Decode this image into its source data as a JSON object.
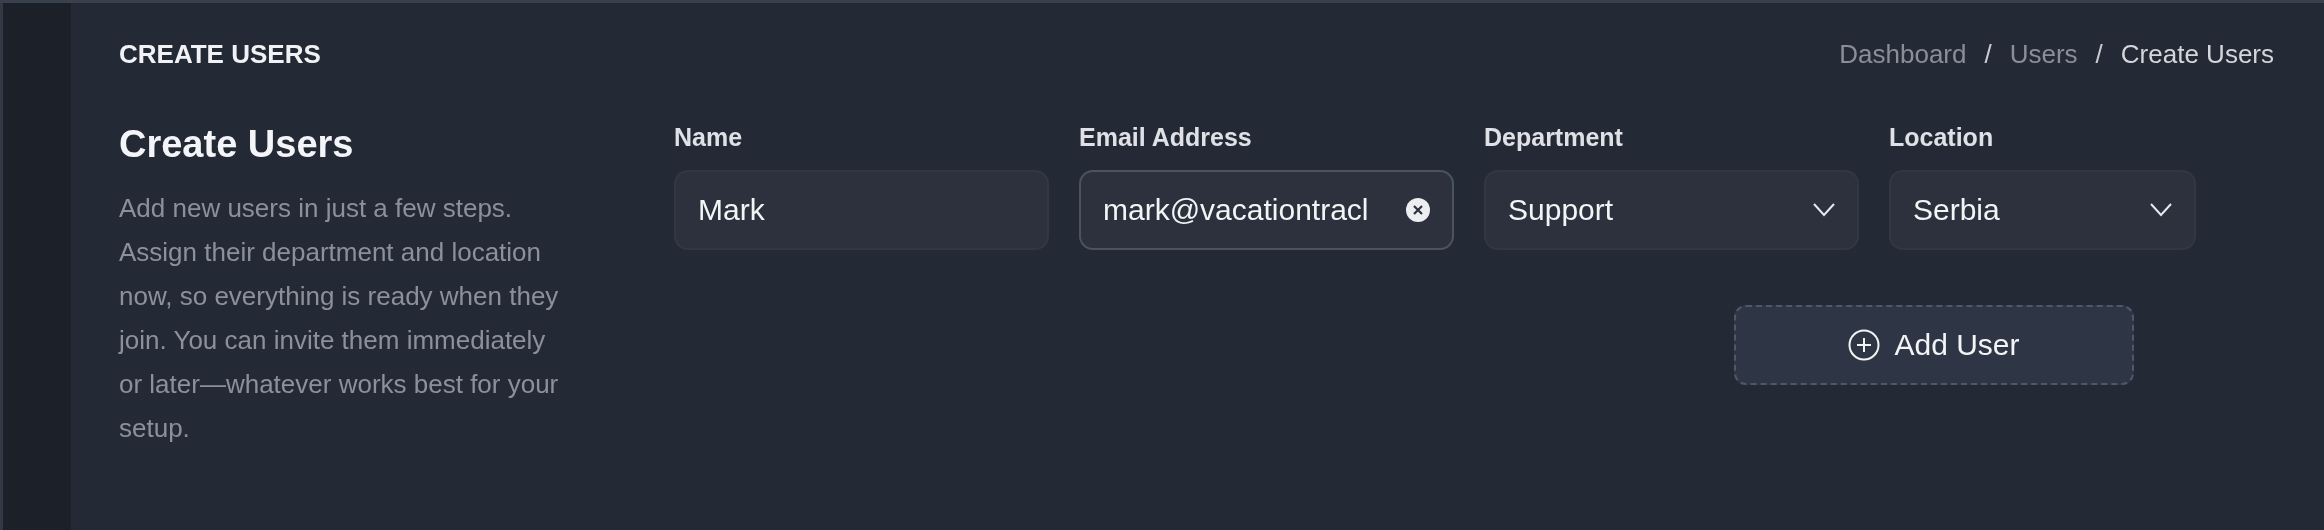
{
  "header": {
    "title": "CREATE USERS",
    "breadcrumb": [
      {
        "label": "Dashboard",
        "current": false
      },
      {
        "label": "Users",
        "current": false
      },
      {
        "label": "Create Users",
        "current": true
      }
    ],
    "separator": "/"
  },
  "intro": {
    "title": "Create Users",
    "description": "Add new users in just a few steps. Assign their department and location now, so everything is ready when they join. You can invite them immediately or later—whatever works best for your setup."
  },
  "fields": [
    {
      "kind": "text",
      "label": "Name",
      "value": "Mark",
      "focused": false
    },
    {
      "kind": "text",
      "label": "Email Address",
      "value": "mark@vacationtracl",
      "focused": true,
      "clearable": true
    },
    {
      "kind": "select",
      "label": "Department",
      "value": "Support",
      "focused": false
    },
    {
      "kind": "select",
      "label": "Location",
      "value": "Serbia",
      "focused": false
    }
  ],
  "add_button": {
    "label": "Add User"
  }
}
